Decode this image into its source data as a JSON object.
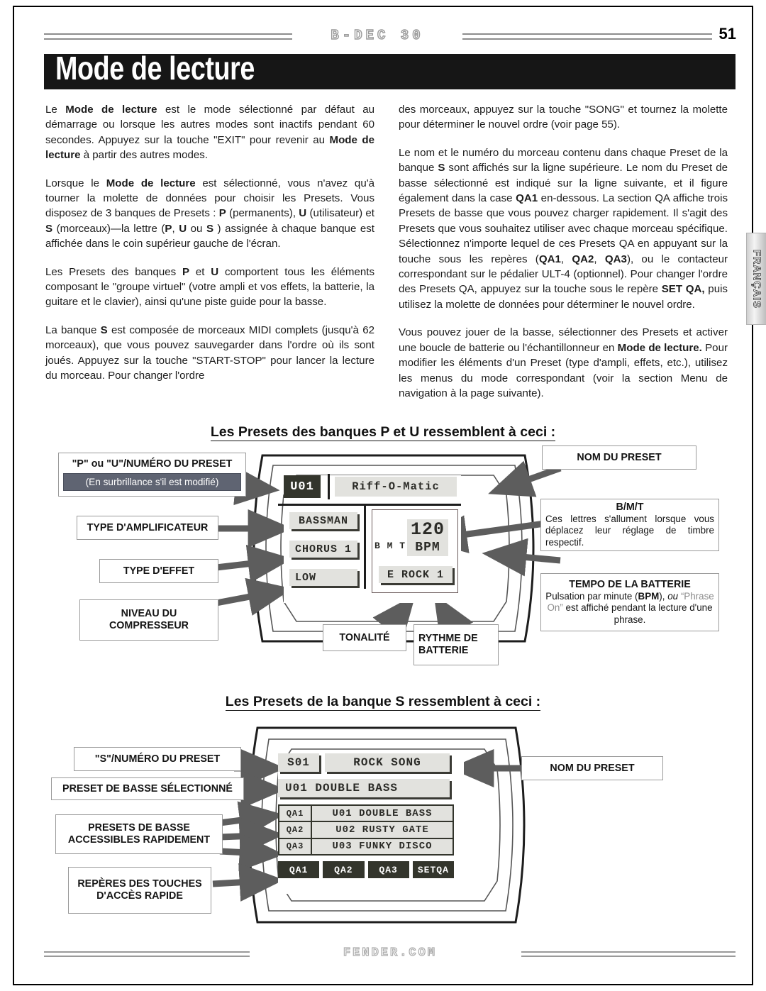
{
  "header": {
    "brand": "B-DEC 30",
    "page_number": "51"
  },
  "title": "Mode de lecture",
  "language_tab": "FRANÇAIS",
  "footer": {
    "brand": "FENDER.COM"
  },
  "body": {
    "left_column": [
      "Le <b>Mode de lecture</b> est le mode sélectionné par défaut au démarrage ou lorsque les autres modes sont inactifs pendant 60 secondes. Appuyez sur la touche \"EXIT\" pour revenir au <b>Mode de lecture</b> à partir des autres modes.",
      "Lorsque le <b>Mode de lecture</b> est sélectionné, vous n'avez qu'à tourner la molette de données pour choisir les Presets. Vous disposez de 3 banques de Presets : <b>P</b> (permanents), <b>U</b> (utilisateur) et <b>S</b> (morceaux)—la lettre (<b>P</b>, <b>U</b> ou <b>S</b> ) assignée à chaque banque est affichée dans le coin supérieur gauche de l'écran.",
      "Les Presets des banques <b>P</b> et <b>U</b> comportent tous les éléments composant le \"groupe virtuel\" (votre ampli et vos effets, la batterie, la guitare et le clavier), ainsi qu'une piste guide pour la basse.",
      "La banque <b>S</b> est composée de morceaux MIDI complets (jusqu'à 62 morceaux), que vous pouvez sauvegarder dans l'ordre où ils sont joués. Appuyez sur la touche \"START-STOP\" pour lancer la lecture du morceau. Pour changer l'ordre"
    ],
    "right_column": [
      "des morceaux, appuyez sur la touche \"SONG\" et tournez la molette pour déterminer le nouvel ordre (voir page 55).",
      "Le nom et le numéro du morceau contenu dans chaque Preset de la banque <b>S</b> sont affichés sur la ligne supérieure. Le nom du Preset de basse sélectionné est indiqué sur la ligne suivante, et il figure également dans la case <b>QA1</b> en-dessous. La section QA affiche trois Presets de basse que vous pouvez charger rapidement. Il s'agit des Presets que vous souhaitez utiliser avec chaque morceau spécifique. Sélectionnez n'importe lequel de ces Presets QA en appuyant sur la touche sous les repères (<b>QA1</b>, <b>QA2</b>, <b>QA3</b>), ou le contacteur correspondant sur le pédalier ULT-4 (optionnel). Pour changer l'ordre des Presets QA, appuyez sur la touche sous le repère <b>SET QA,</b> puis utilisez la molette de données pour déterminer le nouvel ordre.",
      "Vous pouvez jouer de la basse, sélectionner des Presets et activer une boucle de batterie ou l'échantillonneur en <b>Mode de lecture.</b> Pour modifier les éléments d'un Preset (type d'ampli, effets, etc.), utilisez les menus du mode correspondant (voir la section Menu de navigation à la page suivante)."
    ]
  },
  "diagram_pu": {
    "caption_html": "Les Presets des banques <b>P</b> et <b>U</b> ressemblent à ceci :",
    "lcd": {
      "preset_number": "U01",
      "preset_name": "Riff-O-Matic",
      "amp_type": "BASSMAN",
      "effect_type": "CHORUS 1",
      "compressor": "LOW",
      "bmt": "B M T",
      "tempo_value": "120",
      "tempo_unit": "BPM",
      "drum_pattern": "E  ROCK 1"
    },
    "callouts": {
      "preset_number": {
        "title": "\"P\" ou \"U\"/NUMÉRO DU PRESET",
        "highlight": "(En surbrillance s'il est modifié)"
      },
      "amp_type": {
        "title": "TYPE D'AMPLIFICATEUR"
      },
      "effect_type": {
        "title": "TYPE D'EFFET"
      },
      "compressor": {
        "title": "NIVEAU DU",
        "title2": "COMPRESSEUR"
      },
      "preset_name": {
        "title": "NOM DU PRESET"
      },
      "bmt": {
        "title": "B/M/T",
        "body": "Ces lettres s'allument lorsque vous déplacez leur réglage de timbre respectif."
      },
      "tempo": {
        "title": "TEMPO DE LA BATTERIE",
        "body_html": "Pulsation par minute (<b>BPM</b>), <i>ou</i> <span style=\"color:#8b8b8b\">&ldquo;Phrase On&rdquo;</span> est affiché pendant la lecture d'une phrase."
      },
      "tonality": {
        "title": "TONALITÉ"
      },
      "drum_rhythm": {
        "title": "RYTHME  DE",
        "title2": "BATTERIE"
      }
    }
  },
  "diagram_s": {
    "caption_html": "Les Presets de la banque <b>S</b> ressemblent à ceci :",
    "lcd": {
      "song_number": "S01",
      "song_name": "ROCK SONG",
      "bass_preset": "U01  DOUBLE BASS",
      "qa_rows": [
        {
          "label": "QA1",
          "value": "U01 DOUBLE BASS"
        },
        {
          "label": "QA2",
          "value": "U02 RUSTY GATE"
        },
        {
          "label": "QA3",
          "value": "U03 FUNKY DISCO"
        }
      ],
      "soft_keys": [
        "QA1",
        "QA2",
        "QA3",
        "SETQA"
      ]
    },
    "callouts": {
      "preset_number": {
        "title": "\"S\"/NUMÉRO DU PRESET"
      },
      "bass_preset": {
        "title": "PRESET DE BASSE SÉLECTIONNÉ"
      },
      "qa_presets": {
        "title": "PRESETS DE BASSE",
        "title2": "ACCESSIBLES RAPIDEMENT"
      },
      "soft_keys": {
        "title": "REPÈRES DES TOUCHES",
        "title2": "D'ACCÈS RAPIDE"
      },
      "preset_name": {
        "title": "NOM DU PRESET"
      }
    }
  },
  "colors": {
    "lcd_seg_bg": "#e2e2de",
    "lcd_seg_fg": "#2b2b27",
    "lcd_inv_bg": "#33352c",
    "highlight_bg": "#5f6472",
    "title_bar": "#161616"
  }
}
